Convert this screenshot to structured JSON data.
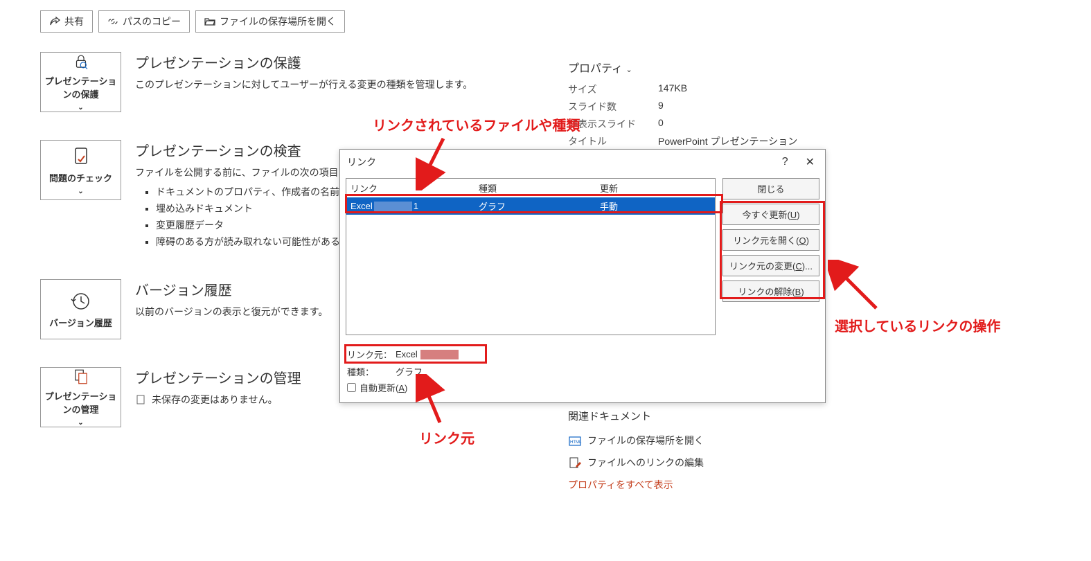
{
  "top_buttons": {
    "share": "共有",
    "copy_path": "パスのコピー",
    "open_location": "ファイルの保存場所を開く"
  },
  "info": {
    "protect": {
      "title": "プレゼンテーションの保護",
      "desc": "このプレゼンテーションに対してユーザーが行える変更の種類を管理します。",
      "btn": "プレゼンテーションの保護"
    },
    "inspect": {
      "title": "プレゼンテーションの検査",
      "desc": "ファイルを公開する前に、ファイルの次の項目を確認",
      "btn": "問題のチェック",
      "items": [
        "ドキュメントのプロパティ、作成者の名前",
        "埋め込みドキュメント",
        "変更履歴データ",
        "障碍のある方が読み取れない可能性があるコ"
      ]
    },
    "version": {
      "title": "バージョン履歴",
      "desc": "以前のバージョンの表示と復元ができます。",
      "btn": "バージョン履歴"
    },
    "manage": {
      "title": "プレゼンテーションの管理",
      "desc": "未保存の変更はありません。",
      "btn": "プレゼンテーションの管理"
    }
  },
  "properties": {
    "title": "プロパティ",
    "rows": {
      "size_l": "サイズ",
      "size_v": "147KB",
      "slides_l": "スライド数",
      "slides_v": "9",
      "hidden_l": "非表示スライド",
      "hidden_v": "0",
      "title_l": "タイトル",
      "title_v": "PowerPoint プレゼンテーション"
    }
  },
  "related": {
    "title": "関連ドキュメント",
    "open_location": "ファイルの保存場所を開く",
    "edit_links": "ファイルへのリンクの編集",
    "show_all": "プロパティをすべて表示"
  },
  "dialog": {
    "title": "リンク",
    "help": "?",
    "headers": {
      "link": "リンク",
      "type": "種類",
      "update": "更新"
    },
    "row": {
      "link_prefix": "Excel",
      "link_suffix": "1",
      "type": "グラフ",
      "update": "手動"
    },
    "buttons": {
      "close": "閉じる",
      "update_now_pre": "今すぐ更新(",
      "update_now_u": "U",
      "update_now_post": ")",
      "open_source_pre": "リンク元を開く(",
      "open_source_u": "O",
      "open_source_post": ")",
      "change_source_pre": "リンク元の変更(",
      "change_source_u": "C",
      "change_source_post": ")...",
      "break_link_pre": "リンクの解除(",
      "break_link_u": "B",
      "break_link_post": ")"
    },
    "footer": {
      "source_l": "リンク元：",
      "source_v": "Excel",
      "type_l": "種類：",
      "type_v": "グラフ",
      "auto_pre": "自動更新(",
      "auto_u": "A",
      "auto_post": ")"
    }
  },
  "annotations": {
    "a1": "リンクされているファイルや種類",
    "a2": "選択しているリンクの操作",
    "a3": "リンク元"
  }
}
